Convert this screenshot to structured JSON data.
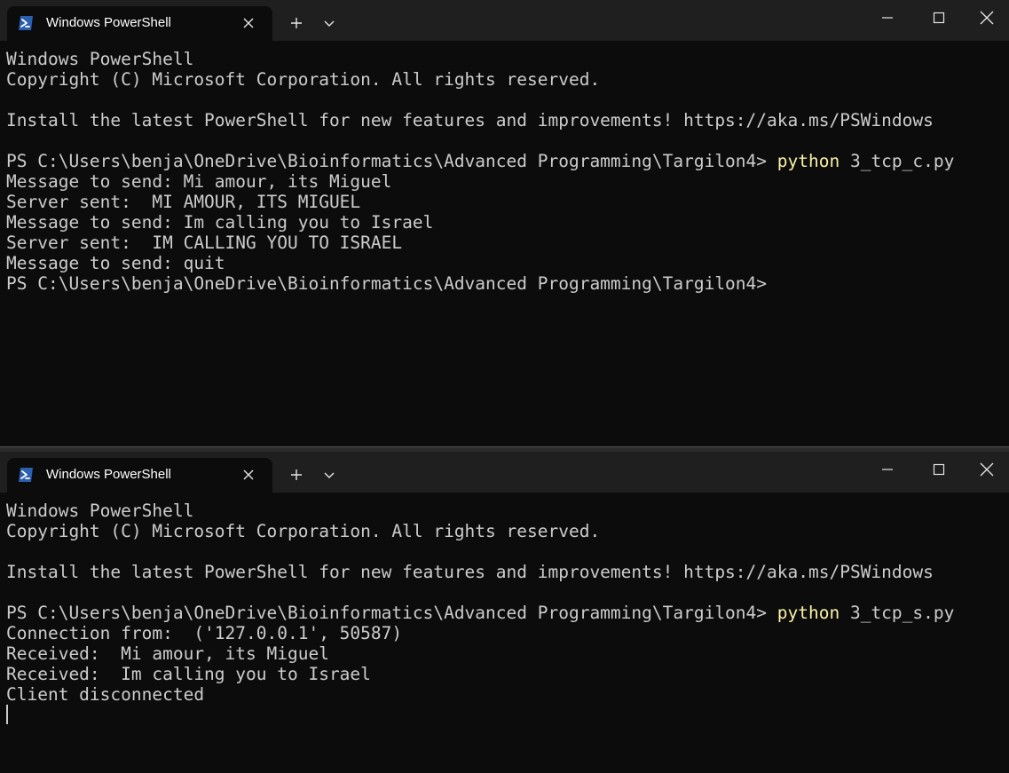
{
  "windows": [
    {
      "tab": {
        "title": "Windows PowerShell",
        "icon": "powershell-icon"
      },
      "controls": {
        "new_tab": "+",
        "minimize": "minimize-icon",
        "maximize": "maximize-icon",
        "close": "close-icon"
      },
      "lines": [
        {
          "text": "Windows PowerShell"
        },
        {
          "text": "Copyright (C) Microsoft Corporation. All rights reserved."
        },
        {
          "text": ""
        },
        {
          "text": "Install the latest PowerShell for new features and improvements! https://aka.ms/PSWindows"
        },
        {
          "text": ""
        },
        {
          "prompt": "PS C:\\Users\\benja\\OneDrive\\Bioinformatics\\Advanced Programming\\Targilon4> ",
          "command": "python",
          "args": " 3_tcp_c.py"
        },
        {
          "text": "Message to send: Mi amour, its Miguel"
        },
        {
          "text": "Server sent:  MI AMOUR, ITS MIGUEL"
        },
        {
          "text": "Message to send: Im calling you to Israel"
        },
        {
          "text": "Server sent:  IM CALLING YOU TO ISRAEL"
        },
        {
          "text": "Message to send: quit"
        },
        {
          "prompt": "PS C:\\Users\\benja\\OneDrive\\Bioinformatics\\Advanced Programming\\Targilon4>",
          "command": "",
          "args": ""
        }
      ]
    },
    {
      "tab": {
        "title": "Windows PowerShell",
        "icon": "powershell-icon"
      },
      "controls": {
        "new_tab": "+",
        "minimize": "minimize-icon",
        "maximize": "maximize-icon",
        "close": "close-icon"
      },
      "lines": [
        {
          "text": "Windows PowerShell"
        },
        {
          "text": "Copyright (C) Microsoft Corporation. All rights reserved."
        },
        {
          "text": ""
        },
        {
          "text": "Install the latest PowerShell for new features and improvements! https://aka.ms/PSWindows"
        },
        {
          "text": ""
        },
        {
          "prompt": "PS C:\\Users\\benja\\OneDrive\\Bioinformatics\\Advanced Programming\\Targilon4> ",
          "command": "python",
          "args": " 3_tcp_s.py"
        },
        {
          "text": "Connection from:  ('127.0.0.1', 50587)"
        },
        {
          "text": "Received:  Mi amour, its Miguel"
        },
        {
          "text": "Received:  Im calling you to Israel"
        },
        {
          "text": "Client disconnected"
        }
      ]
    }
  ],
  "colors": {
    "background": "#0c0c0c",
    "titlebar": "#1f1f1f",
    "text": "#cccccc",
    "command": "#f9f1a5",
    "icon_blue": "#2b5fb0"
  }
}
